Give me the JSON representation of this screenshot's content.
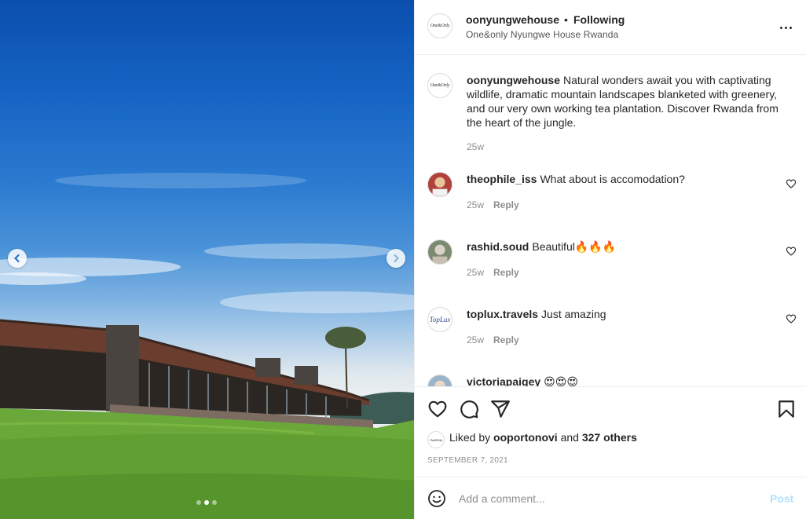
{
  "post": {
    "account": {
      "username": "oonyungwehouse",
      "follow_status": "Following",
      "separator": "•",
      "location": "One&only Nyungwe House Rwanda",
      "avatar_text": "One&Only"
    },
    "caption": {
      "username": "oonyungwehouse",
      "text": "Natural wonders await you with captivating wildlife, dramatic mountain landscapes blanketed with greenery, and our very own working tea plantation. Discover Rwanda from the heart of the jungle.",
      "age": "25w"
    },
    "comments": [
      {
        "username": "theophile_iss",
        "text": "What about is accomodation?",
        "age": "25w",
        "reply_label": "Reply",
        "avatar": "photo"
      },
      {
        "username": "rashid.soud",
        "text": "Beautiful🔥🔥🔥",
        "age": "25w",
        "reply_label": "Reply",
        "avatar": "photo"
      },
      {
        "username": "toplux.travels",
        "text": "Just amazing",
        "age": "25w",
        "reply_label": "Reply",
        "avatar": "TopLux"
      },
      {
        "username": "victoriapaigey",
        "text": "😍😍😍",
        "age": "",
        "reply_label": "",
        "avatar": "photo"
      }
    ],
    "likes": {
      "prefix": "Liked by",
      "user": "ooportonovi",
      "joiner": "and",
      "others": "327 others"
    },
    "date": "SEPTEMBER 7, 2021",
    "comment_box": {
      "placeholder": "Add a comment...",
      "post_label": "Post"
    },
    "carousel": {
      "slide_count": 3,
      "active_index": 1
    }
  },
  "icons": {
    "more": "more-horizontal-icon",
    "like": "heart-icon",
    "comment": "comment-bubble-icon",
    "share": "paper-plane-icon",
    "save": "bookmark-icon",
    "emoji": "smiley-icon",
    "prev": "chevron-left-icon",
    "next": "chevron-right-icon"
  },
  "colors": {
    "text": "#262626",
    "muted": "#8e8e8e",
    "post_disabled": "#b2dffc",
    "border": "#efefef"
  }
}
